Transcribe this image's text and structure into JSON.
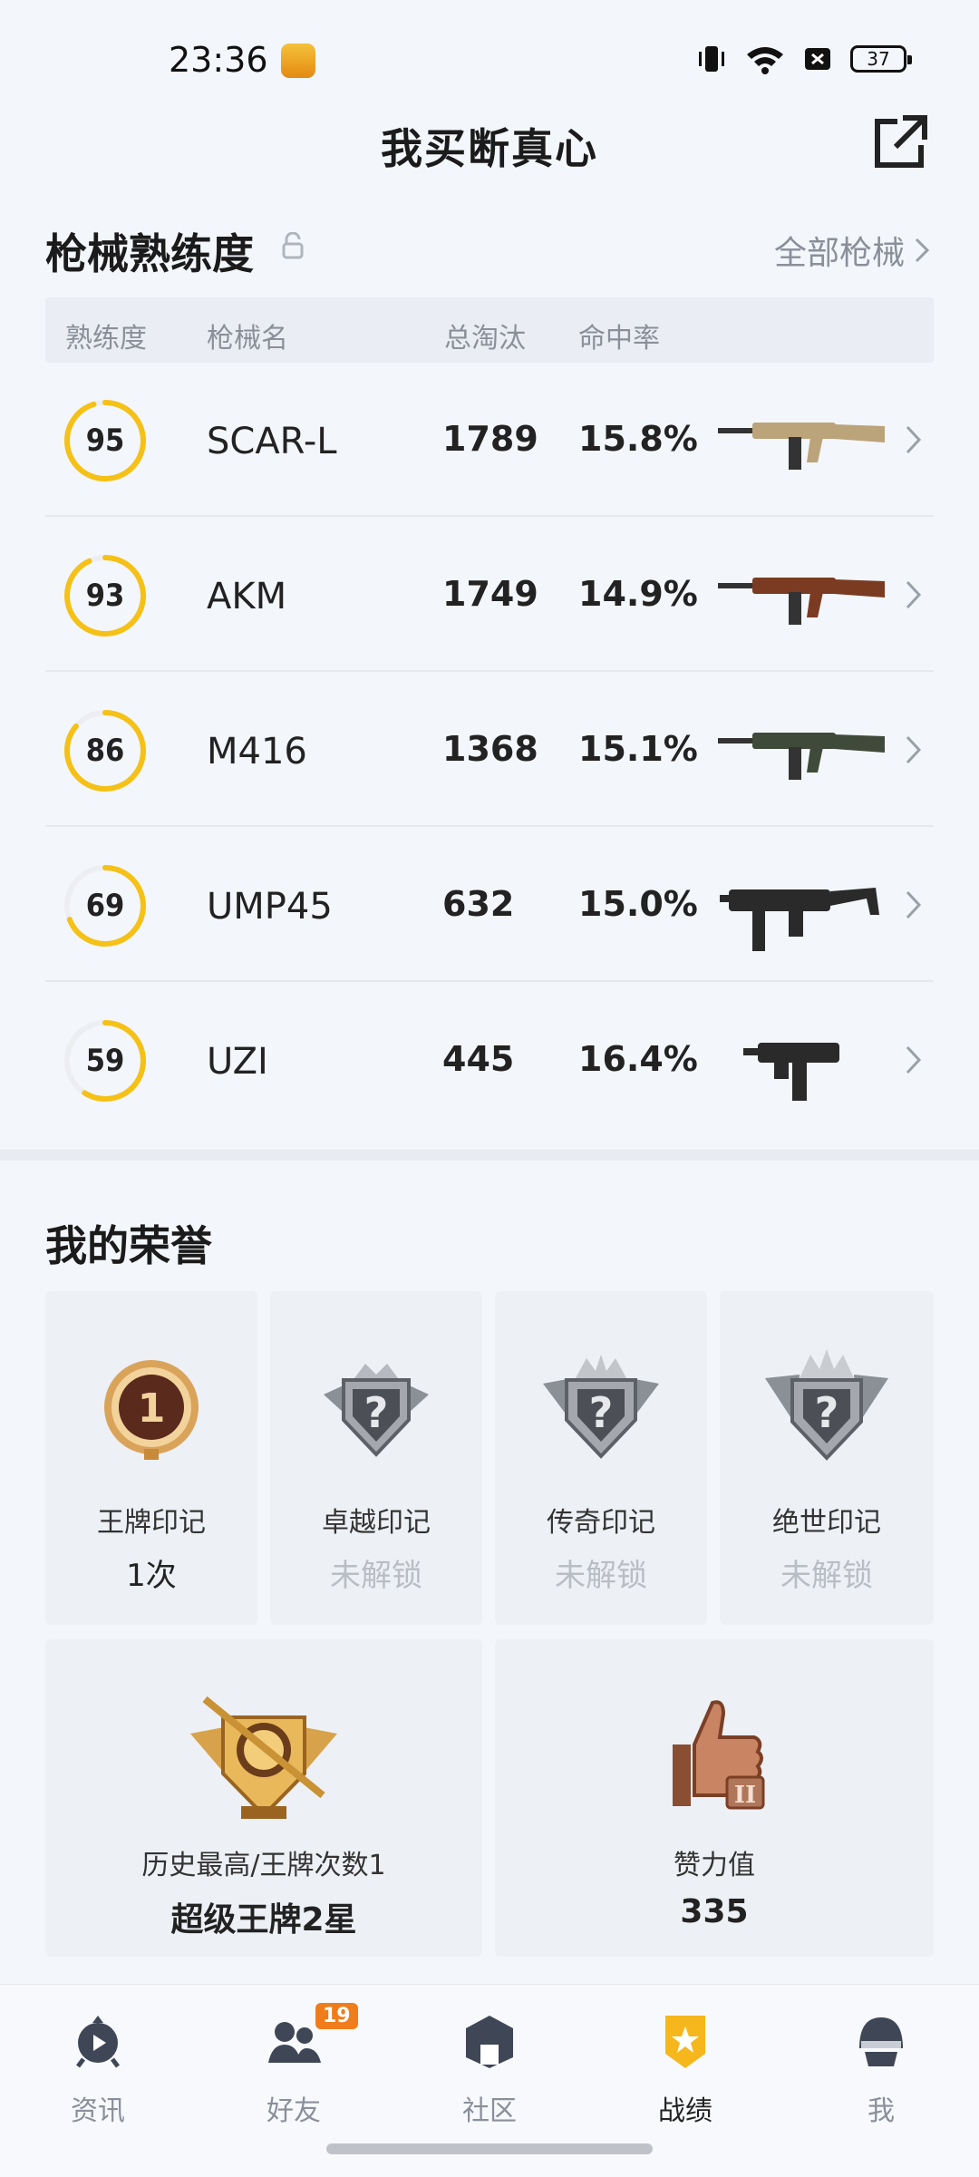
{
  "status_bar": {
    "time": "23:36",
    "battery": "37"
  },
  "header": {
    "title": "我买断真心"
  },
  "gun_section": {
    "title": "枪械熟练度",
    "all_link": "全部枪械",
    "columns": [
      "熟练度",
      "枪械名",
      "总淘汰",
      "命中率"
    ],
    "rows": [
      {
        "level": "95",
        "proficiency": 0.95,
        "name": "SCAR-L",
        "kills": "1789",
        "accuracy": "15.8%",
        "gun_color": "#bba37a"
      },
      {
        "level": "93",
        "proficiency": 0.93,
        "name": "AKM",
        "kills": "1749",
        "accuracy": "14.9%",
        "gun_color": "#7a3b22"
      },
      {
        "level": "86",
        "proficiency": 0.86,
        "name": "M416",
        "kills": "1368",
        "accuracy": "15.1%",
        "gun_color": "#3f4a3a"
      },
      {
        "level": "69",
        "proficiency": 0.69,
        "name": "UMP45",
        "kills": "632",
        "accuracy": "15.0%",
        "gun_color": "#2a2a2a"
      },
      {
        "level": "59",
        "proficiency": 0.59,
        "name": "UZI",
        "kills": "445",
        "accuracy": "16.4%",
        "gun_color": "#2a2a2a"
      }
    ]
  },
  "honor_section": {
    "title": "我的荣誉",
    "marks": [
      {
        "label": "王牌印记",
        "value": "1次",
        "locked": false
      },
      {
        "label": "卓越印记",
        "value": "未解锁",
        "locked": true
      },
      {
        "label": "传奇印记",
        "value": "未解锁",
        "locked": true
      },
      {
        "label": "绝世印记",
        "value": "未解锁",
        "locked": true
      }
    ],
    "highest": {
      "label": "历史最高/王牌次数1",
      "value": "超级王牌2星"
    },
    "likes": {
      "label": "赞力值",
      "value": "335"
    }
  },
  "bottom_nav": [
    {
      "label": "资讯",
      "icon": "news-icon",
      "active": false
    },
    {
      "label": "好友",
      "icon": "friends-icon",
      "active": false,
      "badge": "19"
    },
    {
      "label": "社区",
      "icon": "community-icon",
      "active": false
    },
    {
      "label": "战绩",
      "icon": "record-icon",
      "active": true
    },
    {
      "label": "我",
      "icon": "profile-icon",
      "active": false
    }
  ],
  "colors": {
    "accent": "#f5c116",
    "ring_track": "#eceef2",
    "orange_badge": "#f07c1b"
  }
}
